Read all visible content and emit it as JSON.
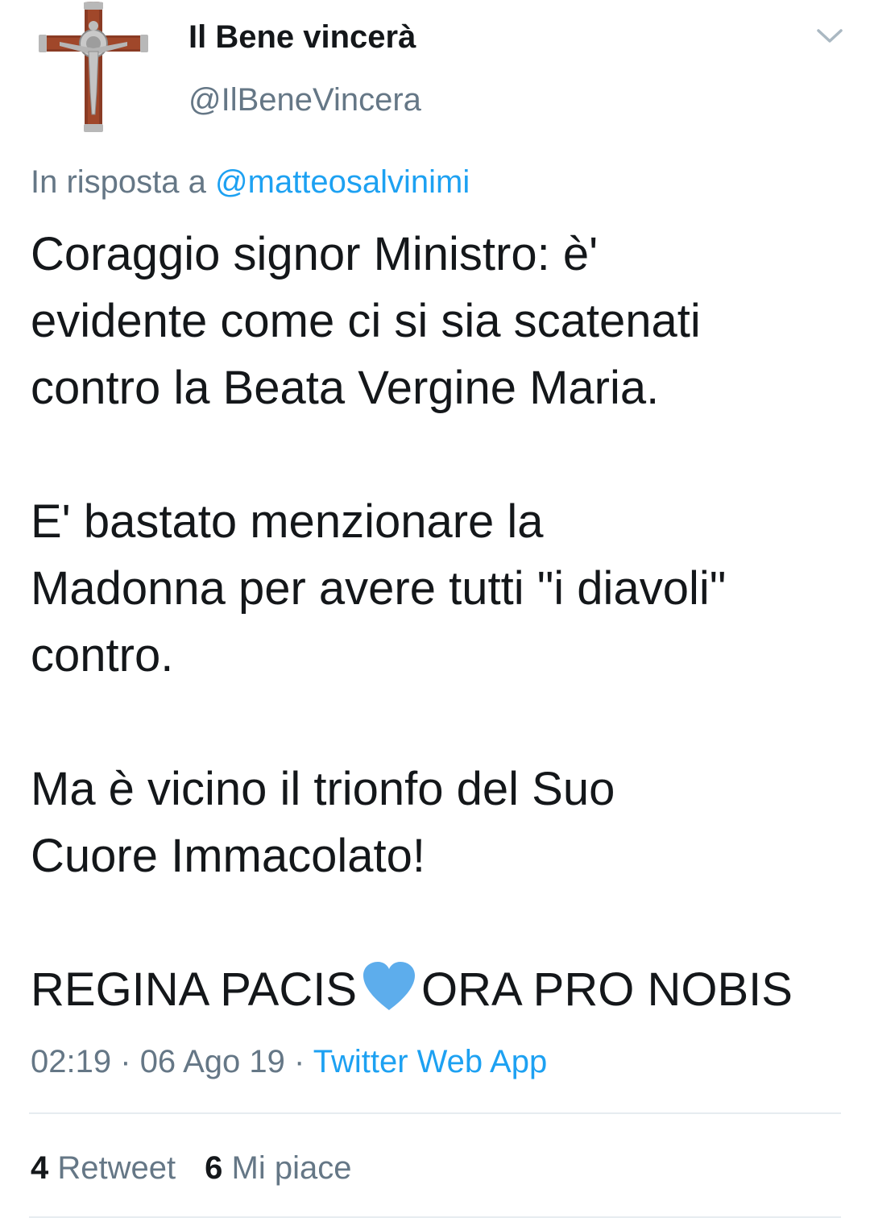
{
  "user": {
    "display_name": "Il Bene vincerà",
    "handle": "@IlBeneVincera",
    "avatar_icon": "crucifix-icon"
  },
  "reply": {
    "prefix": "In risposta a",
    "mention": "@matteosalvinimi"
  },
  "tweet": {
    "lines": [
      "Coraggio signor Ministro: è'",
      "evidente come ci si sia scatenati",
      "contro la Beata Vergine Maria.",
      "",
      "E' bastato menzionare la",
      "Madonna per avere tutti \"i diavoli\"",
      "contro.",
      "",
      "Ma è vicino il trionfo del Suo",
      "Cuore Immacolato!",
      ""
    ],
    "last_line_before": "REGINA PACIS",
    "last_line_emoji": "blue-heart-icon",
    "last_line_after": "ORA PRO NOBIS"
  },
  "meta": {
    "time": "02:19",
    "date": "06 Ago 19",
    "separator": "·",
    "source": "Twitter Web App"
  },
  "stats": {
    "retweets_count": "4",
    "retweets_label": "Retweet",
    "likes_count": "6",
    "likes_label": "Mi piace"
  },
  "colors": {
    "text": "#14171a",
    "secondary": "#657786",
    "link": "#1da1f2",
    "heart": "#5dadec",
    "divider": "#e6ecf0"
  }
}
